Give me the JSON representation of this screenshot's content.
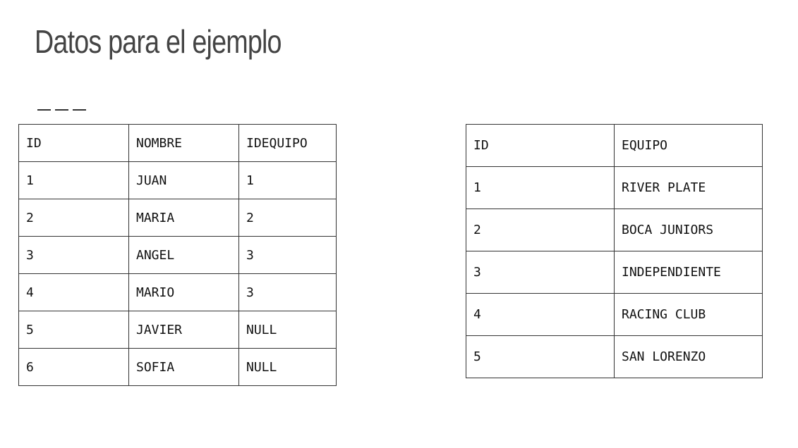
{
  "slide": {
    "title": "Datos para el ejemplo"
  },
  "table_personas": {
    "headers": [
      "ID",
      "NOMBRE",
      "IDEQUIPO"
    ],
    "rows": [
      [
        "1",
        "JUAN",
        "1"
      ],
      [
        "2",
        "MARIA",
        "2"
      ],
      [
        "3",
        "ANGEL",
        "3"
      ],
      [
        "4",
        "MARIO",
        "3"
      ],
      [
        "5",
        "JAVIER",
        "NULL"
      ],
      [
        "6",
        "SOFIA",
        "NULL"
      ]
    ]
  },
  "table_equipos": {
    "headers": [
      "ID",
      "EQUIPO"
    ],
    "rows": [
      [
        "1",
        "RIVER PLATE"
      ],
      [
        "2",
        "BOCA JUNIORS"
      ],
      [
        "3",
        "INDEPENDIENTE"
      ],
      [
        "4",
        "RACING CLUB"
      ],
      [
        "5",
        "SAN LORENZO"
      ]
    ]
  }
}
